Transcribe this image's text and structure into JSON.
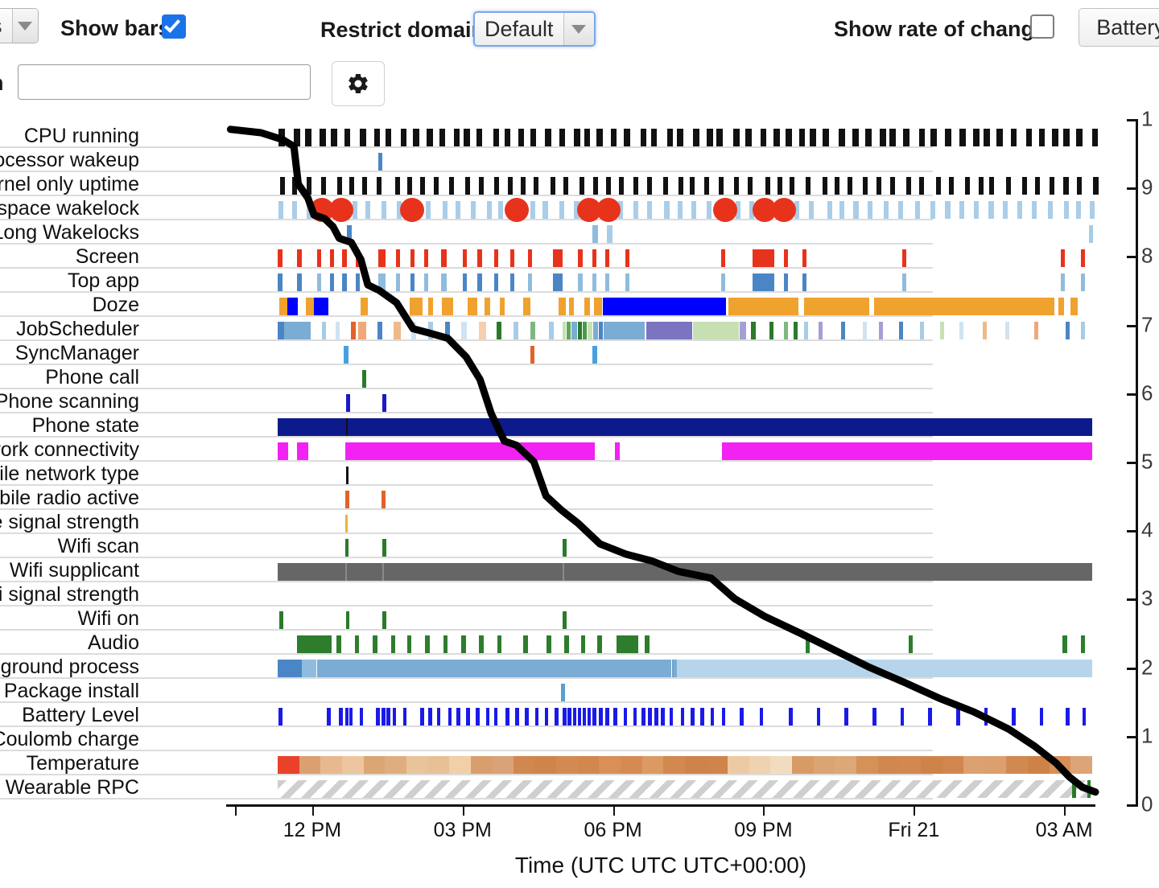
{
  "toolbar": {
    "left_select_value": "s",
    "show_bars_label": "Show bars",
    "show_bars_checked": true,
    "restrict_domain_label": "Restrict domain",
    "restrict_domain_value": "Default",
    "show_rate_of_change_label": "Show rate of change",
    "show_rate_of_change_checked": false,
    "battery_button_label": "Battery",
    "search_label": "h",
    "search_value": "",
    "search_placeholder": "",
    "gear_icon": "gear-icon",
    "dropdown_icon": "chevron-down-icon"
  },
  "chart_data": {
    "type": "timeline",
    "title": "",
    "xlabel": "Time (UTC UTC UTC+00:00)",
    "ylabel": "",
    "x_tick_labels": [
      "12 PM",
      "03 PM",
      "06 PM",
      "09 PM",
      "Fri 21",
      "03 AM"
    ],
    "x_tick_positions_pct": [
      9.9,
      27.2,
      44.5,
      61.8,
      79.1,
      96.4
    ],
    "y_tick_labels": [
      "1",
      "9",
      "8",
      "7",
      "6",
      "5",
      "4",
      "3",
      "2",
      "1",
      "0"
    ],
    "y_tick_positions_pct": [
      0,
      10,
      20,
      30,
      40,
      50,
      60,
      70,
      80,
      90,
      100
    ],
    "grid": true,
    "legend": "none",
    "battery_series": {
      "name": "Battery Level",
      "color": "#000000",
      "points_pct": [
        [
          0.5,
          1.5
        ],
        [
          4.0,
          2.0
        ],
        [
          6.5,
          3.0
        ],
        [
          7.8,
          4.0
        ],
        [
          8.3,
          9.5
        ],
        [
          9.4,
          11.5
        ],
        [
          10.1,
          14.0
        ],
        [
          11.3,
          14.5
        ],
        [
          12.3,
          15.7
        ],
        [
          13.0,
          17.4
        ],
        [
          14.4,
          18.0
        ],
        [
          15.5,
          20.5
        ],
        [
          16.3,
          24.2
        ],
        [
          17.6,
          25.0
        ],
        [
          19.6,
          26.8
        ],
        [
          21.5,
          30.6
        ],
        [
          23.3,
          31.2
        ],
        [
          25.5,
          32.0
        ],
        [
          27.6,
          34.7
        ],
        [
          29.2,
          38.0
        ],
        [
          30.5,
          43.0
        ],
        [
          32.0,
          47.0
        ],
        [
          33.4,
          47.6
        ],
        [
          35.4,
          50.0
        ],
        [
          36.8,
          55.0
        ],
        [
          38.5,
          57.0
        ],
        [
          40.5,
          59.0
        ],
        [
          43.0,
          62.0
        ],
        [
          46.0,
          63.5
        ],
        [
          49.0,
          64.5
        ],
        [
          52.0,
          66.0
        ],
        [
          55.8,
          67.0
        ],
        [
          58.5,
          70.0
        ],
        [
          62.0,
          72.6
        ],
        [
          66.0,
          75.0
        ],
        [
          70.0,
          77.5
        ],
        [
          74.0,
          80.0
        ],
        [
          78.0,
          82.2
        ],
        [
          82.0,
          84.5
        ],
        [
          86.0,
          86.5
        ],
        [
          90.0,
          89.0
        ],
        [
          93.0,
          91.5
        ],
        [
          95.5,
          94.0
        ],
        [
          97.0,
          96.0
        ],
        [
          98.5,
          97.5
        ],
        [
          100.0,
          98.2
        ]
      ]
    },
    "rows": [
      {
        "label": "CPU running",
        "color": "#111111"
      },
      {
        "label": "op Processor wakeup",
        "color": "#4a86c5"
      },
      {
        "label": "Kernel only uptime",
        "color": "#111111"
      },
      {
        "label": "Userspace wakelock",
        "color": "#aacde8"
      },
      {
        "label": "Long Wakelocks",
        "color": "#4a86c5"
      },
      {
        "label": "Screen",
        "color": "#e8331c"
      },
      {
        "label": "Top app",
        "color": "#4a86c5"
      },
      {
        "label": "Doze",
        "color": "#f0a22e"
      },
      {
        "label": "JobScheduler",
        "color": "#7bacd4"
      },
      {
        "label": "SyncManager",
        "color": "#46a0e0"
      },
      {
        "label": "Phone call",
        "color": "#2a7a2a"
      },
      {
        "label": "Phone scanning",
        "color": "#1a1ac8"
      },
      {
        "label": "Phone state",
        "color": "#0d1a8c"
      },
      {
        "label": "Network connectivity",
        "color": "#f222f2"
      },
      {
        "label": "Mobile network type",
        "color": "#111111"
      },
      {
        "label": "Mobile radio active",
        "color": "#e2622a"
      },
      {
        "label": "Mobile signal strength",
        "color": "#e8b43c"
      },
      {
        "label": "Wifi scan",
        "color": "#2a7a2a"
      },
      {
        "label": "Wifi supplicant",
        "color": "#666666"
      },
      {
        "label": "Wifi signal strength",
        "color": "#888888"
      },
      {
        "label": "Wifi on",
        "color": "#2a7a2a"
      },
      {
        "label": "Audio",
        "color": "#2a7a2a"
      },
      {
        "label": "Foreground process",
        "color": "#7bacd4"
      },
      {
        "label": "Package install",
        "color": "#5c9ed0"
      },
      {
        "label": "Battery Level",
        "color": "#1a1ae8"
      },
      {
        "label": "Coulomb charge",
        "color": "#888888"
      },
      {
        "label": "Temperature",
        "color": "#e8603c"
      },
      {
        "label": "Wearable RPC",
        "color": "#cccccc"
      }
    ]
  },
  "colors": {
    "accent_blue": "#1a73e8",
    "red_dot": "#e8331c",
    "doze_orange": "#f0a22e",
    "doze_blue": "#0000ff",
    "magenta": "#f222f2",
    "navy": "#0d1a8c",
    "gray_bar": "#666666"
  }
}
